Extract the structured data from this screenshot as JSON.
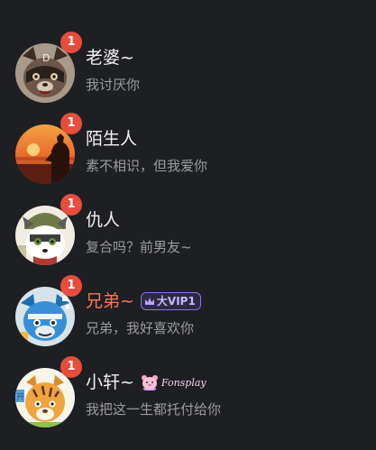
{
  "conversations": [
    {
      "name": "老婆~",
      "message": "我讨厌你",
      "unread": "1",
      "vip": false,
      "avatar": "raccoon-face-avatar"
    },
    {
      "name": "陌生人",
      "message": "素不相识，但我爱你",
      "unread": "1",
      "vip": false,
      "avatar": "sunset-silhouette-avatar"
    },
    {
      "name": "仇人",
      "message": "复合吗？前男友~",
      "unread": "1",
      "vip": false,
      "avatar": "cartoon-wolf-avatar"
    },
    {
      "name": "兄弟~",
      "message": "兄弟，我好喜欢你",
      "unread": "1",
      "vip": true,
      "vip_label": "大VIP1",
      "avatar": "blue-dragon-avatar"
    },
    {
      "name": "小轩~",
      "message": "我把这一生都托付给你",
      "unread": "1",
      "vip": false,
      "decoration_text": "Fonsplay",
      "avatar": "tiger-cartoon-avatar"
    }
  ],
  "colors": {
    "background": "#1e1f22",
    "badge": "#e64d3b",
    "vip_name": "#f47a56",
    "name": "#f2f2f2",
    "message": "#9b9ca1"
  }
}
